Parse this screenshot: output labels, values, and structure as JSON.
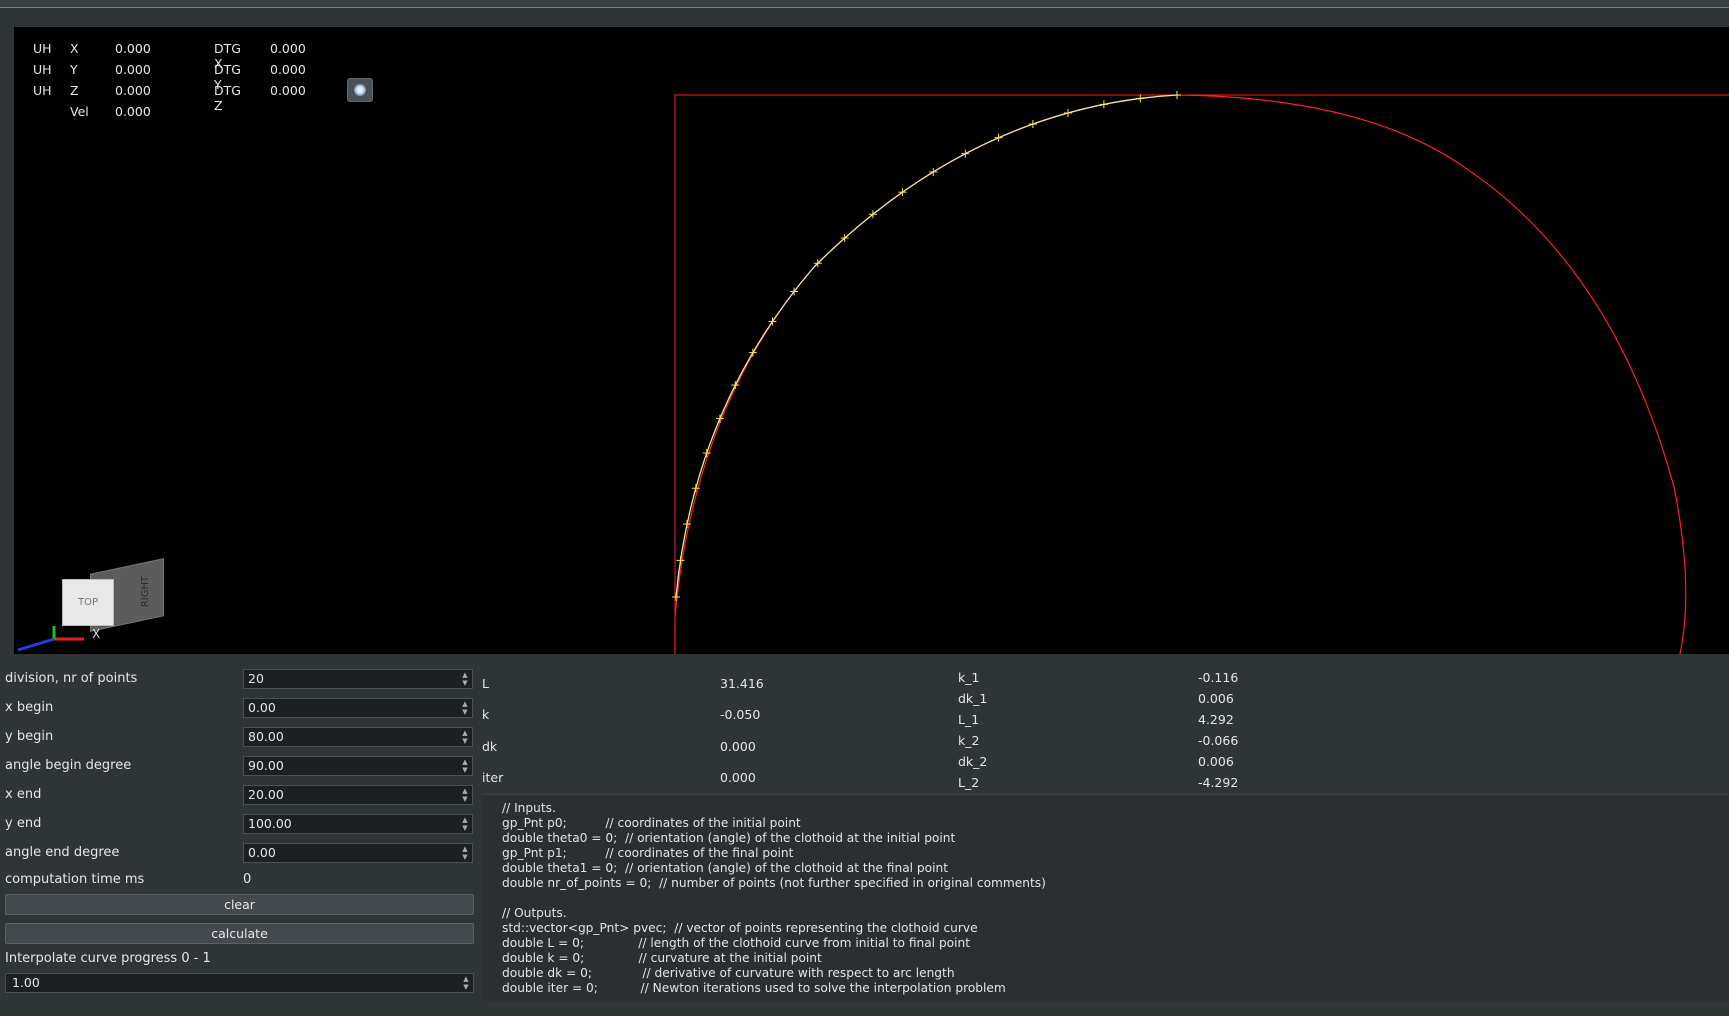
{
  "window": {
    "title": ""
  },
  "hud": {
    "rows": [
      {
        "pre": "UH",
        "axis": "X",
        "val": "0.000",
        "dtg_label": "DTG X",
        "dtg_val": "0.000"
      },
      {
        "pre": "UH",
        "axis": "Y",
        "val": "0.000",
        "dtg_label": "DTG Y",
        "dtg_val": "0.000"
      },
      {
        "pre": "UH",
        "axis": "Z",
        "val": "0.000",
        "dtg_label": "DTG Z",
        "dtg_val": "0.000"
      }
    ],
    "vel_label": "Vel",
    "vel_val": "0.000"
  },
  "view_cube": {
    "top": "TOP",
    "right": "RIGHT",
    "axis_x": "X"
  },
  "inputs": {
    "division_label": "division, nr of points",
    "division_val": "20",
    "xbegin_label": "x begin",
    "xbegin_val": "0.00",
    "ybegin_label": "y begin",
    "ybegin_val": "80.00",
    "anglebegin_label": "angle begin degree",
    "anglebegin_val": "90.00",
    "xend_label": "x end",
    "xend_val": "20.00",
    "yend_label": "y end",
    "yend_val": "100.00",
    "angleend_label": "angle end degree",
    "angleend_val": "0.00",
    "comptime_label": "computation time ms",
    "comptime_val": "0",
    "clear_label": "clear",
    "calculate_label": "calculate",
    "interp_label": "Interpolate curve progress 0 - 1",
    "interp_val": "1.00"
  },
  "results_left": [
    {
      "label": "L",
      "value": "31.416"
    },
    {
      "label": "k",
      "value": "-0.050"
    },
    {
      "label": "dk",
      "value": "0.000"
    },
    {
      "label": "iter",
      "value": "0.000"
    }
  ],
  "results_right": [
    {
      "label": "k_1",
      "value": "-0.116"
    },
    {
      "label": "dk_1",
      "value": "0.006"
    },
    {
      "label": "L_1",
      "value": "4.292"
    },
    {
      "label": "k_2",
      "value": "-0.066"
    },
    {
      "label": "dk_2",
      "value": "0.006"
    },
    {
      "label": "L_2",
      "value": "-4.292"
    }
  ],
  "code": [
    "// Inputs.",
    "gp_Pnt p0;          // coordinates of the initial point",
    "double theta0 = 0;  // orientation (angle) of the clothoid at the initial point",
    "gp_Pnt p1;          // coordinates of the final point",
    "double theta1 = 0;  // orientation (angle) of the clothoid at the final point",
    "double nr_of_points = 0;  // number of points (not further specified in original comments)",
    "",
    "// Outputs.",
    "std::vector<gp_Pnt> pvec;  // vector of points representing the clothoid curve",
    "double L = 0;              // length of the clothoid curve from initial to final point",
    "double k = 0;              // curvature at the initial point",
    "double dk = 0;             // derivative of curvature with respect to arc length",
    "double iter = 0;           // Newton iterations used to solve the interpolation problem"
  ],
  "colors": {
    "curve": "#ff2020",
    "clothoid": "#f0e8a0",
    "markers": "#ffe84a",
    "background": "#000000"
  }
}
